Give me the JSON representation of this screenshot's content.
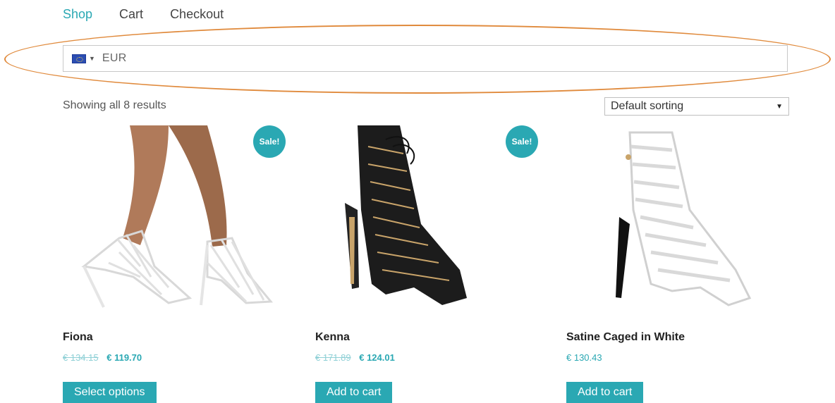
{
  "nav": {
    "items": [
      {
        "label": "Shop"
      },
      {
        "label": "Cart"
      },
      {
        "label": "Checkout"
      }
    ]
  },
  "currency": {
    "value": "EUR",
    "flag_icon": "eu-flag-icon"
  },
  "results": {
    "text": "Showing all 8 results"
  },
  "sorting": {
    "selected": "Default sorting"
  },
  "products": [
    {
      "name": "Fiona",
      "old_price": "€ 134.15",
      "price": "€ 119.70",
      "button": "Select options",
      "badge": "Sale!",
      "image_icon": "white-caged-heels-on-legs"
    },
    {
      "name": "Kenna",
      "old_price": "€ 171.89",
      "price": "€ 124.01",
      "button": "Add to cart",
      "badge": "Sale!",
      "image_icon": "black-lace-up-heel-boot"
    },
    {
      "name": "Satine Caged in White",
      "price": "€ 130.43",
      "button": "Add to cart",
      "image_icon": "white-caged-sandal-heel"
    }
  ],
  "colors": {
    "accent": "#2aa8b3",
    "annotation": "#e08a3c"
  }
}
